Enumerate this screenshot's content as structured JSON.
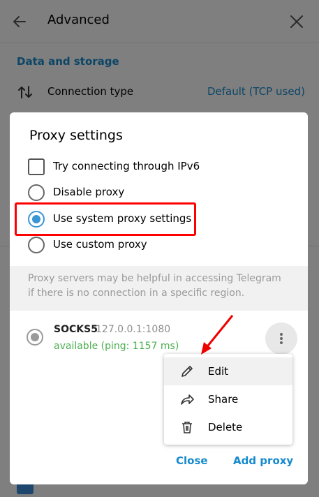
{
  "background": {
    "title": "Advanced",
    "section": "Data and storage",
    "connection_label": "Connection type",
    "connection_value": "Default (TCP used)"
  },
  "dialog": {
    "title": "Proxy settings",
    "options": {
      "ipv6": "Try connecting through IPv6",
      "disable": "Disable proxy",
      "system": "Use system proxy settings",
      "custom": "Use custom proxy"
    },
    "info": "Proxy servers may be helpful in accessing Telegram if there is no connection in a specific region.",
    "proxy": {
      "type": "SOCKS5",
      "address": "127.0.0.1:1080",
      "status": "available (ping: 1157 ms)"
    },
    "menu": {
      "edit": "Edit",
      "share": "Share",
      "delete": "Delete"
    },
    "close_label": "Close",
    "add_label": "Add proxy"
  },
  "colors": {
    "accent": "#168acd",
    "status_ok": "#4caf50",
    "highlight": "#ff0000"
  }
}
